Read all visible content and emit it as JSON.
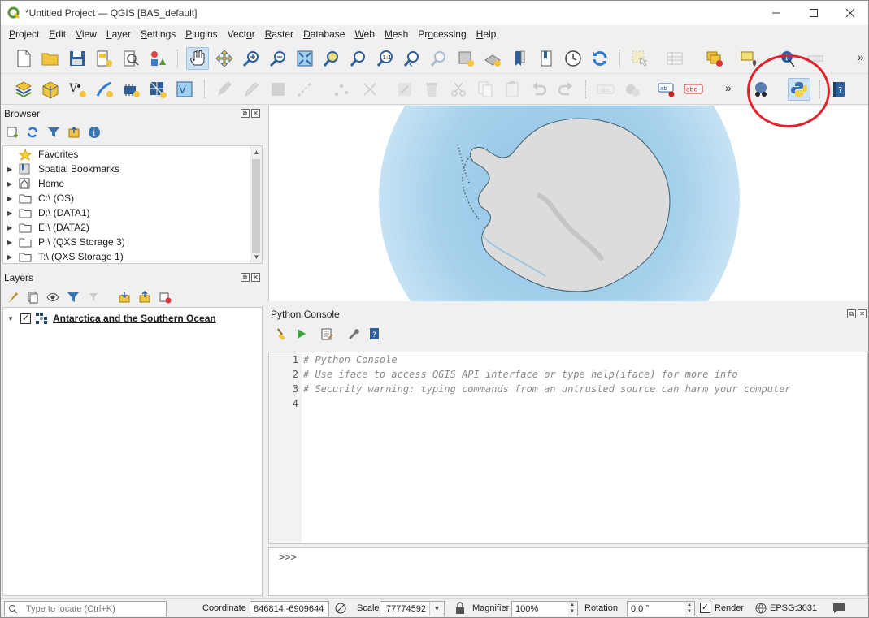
{
  "window": {
    "title": "*Untitled Project — QGIS [BAS_default]"
  },
  "menu": [
    {
      "label": "Project",
      "ul": "P",
      "rest": "roject"
    },
    {
      "label": "Edit",
      "ul": "E",
      "rest": "dit"
    },
    {
      "label": "View",
      "ul": "V",
      "rest": "iew"
    },
    {
      "label": "Layer",
      "ul": "L",
      "rest": "ayer"
    },
    {
      "label": "Settings",
      "ul": "S",
      "rest": "ettings"
    },
    {
      "label": "Plugins",
      "ul": "P",
      "rest": "lugins"
    },
    {
      "label": "Vector",
      "ul": "o",
      "pre": "Vect",
      "rest": "r"
    },
    {
      "label": "Raster",
      "ul": "R",
      "rest": "aster"
    },
    {
      "label": "Database",
      "ul": "D",
      "rest": "atabase"
    },
    {
      "label": "Web",
      "ul": "W",
      "rest": "eb"
    },
    {
      "label": "Mesh",
      "ul": "M",
      "rest": "esh"
    },
    {
      "label": "Processing",
      "ul": "o",
      "pre": "Pr",
      "rest": "cessing"
    },
    {
      "label": "Help",
      "ul": "H",
      "rest": "elp"
    }
  ],
  "toolbar_overflow": "»",
  "browser": {
    "title": "Browser",
    "items": [
      {
        "label": "Favorites",
        "icon": "star-icon",
        "expand": false
      },
      {
        "label": "Spatial Bookmarks",
        "icon": "bookmark-icon",
        "expand": true
      },
      {
        "label": "Home",
        "icon": "home-folder-icon",
        "expand": true
      },
      {
        "label": "C:\\ (OS)",
        "icon": "folder-icon",
        "expand": true
      },
      {
        "label": "D:\\ (DATA1)",
        "icon": "folder-icon",
        "expand": true
      },
      {
        "label": "E:\\ (DATA2)",
        "icon": "folder-icon",
        "expand": true
      },
      {
        "label": "P:\\ (QXS Storage 3)",
        "icon": "folder-icon",
        "expand": true
      },
      {
        "label": "T:\\ (QXS Storage 1)",
        "icon": "folder-icon",
        "expand": true
      }
    ]
  },
  "layers": {
    "title": "Layers",
    "items": [
      {
        "label": "Antarctica and the Southern Ocean",
        "checked": true
      }
    ]
  },
  "console": {
    "title": "Python Console",
    "lines": [
      {
        "n": "1",
        "text": "# Python Console"
      },
      {
        "n": "2",
        "text": "# Use iface to access QGIS API interface or type help(iface) for more info"
      },
      {
        "n": "3",
        "text": "# Security warning: typing commands from an untrusted source can harm your computer"
      },
      {
        "n": "4",
        "text": ""
      }
    ],
    "prompt": ">>>"
  },
  "status": {
    "locate_placeholder": "Type to locate (Ctrl+K)",
    "coordinate_label": "Coordinate",
    "coordinate_value": "846814,-6909644",
    "scale_label": "Scale",
    "scale_value": ":77774592",
    "magnifier_label": "Magnifier",
    "magnifier_value": "100%",
    "rotation_label": "Rotation",
    "rotation_value": "0.0 °",
    "render_label": "Render",
    "render_checked": true,
    "crs": "EPSG:3031"
  },
  "colors": {
    "accent": "#589632",
    "highlight_circle": "#e2222b",
    "ocean": "#a9d0e8",
    "land": "#d9d9d9"
  }
}
